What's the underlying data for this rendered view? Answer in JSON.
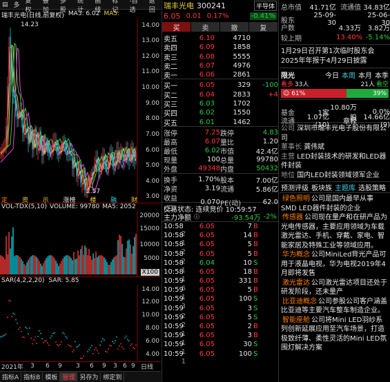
{
  "toolbar": {
    "items": [
      "多",
      "复权",
      "叠加",
      "多股",
      "统计",
      "画线",
      "标记",
      "-自选",
      "返回"
    ]
  },
  "kline": {
    "title": "瑞丰光电(日线,前复权)",
    "ma3_label": "MA3: 6.02",
    "ma5_label": "MA5:",
    "high_label": "14.23",
    "low_label": "2.57",
    "yticks": [
      "14.00",
      "13.00",
      "12.00",
      "11.00",
      "10.00",
      "9.00",
      "8.00",
      "7.00",
      "6.00",
      "5.00",
      "4.00",
      "3.00"
    ],
    "markers": [
      "定",
      "资",
      "示",
      "涨榜",
      "楼",
      "融",
      "财"
    ]
  },
  "volume": {
    "title": "VOL-TDX(5,10)",
    "volume_label": "VOLUME: 99780",
    "ma5_label": "MA5: 2052",
    "yticks": [
      "20000",
      "15000",
      "10000",
      "5000",
      "X100"
    ]
  },
  "sar": {
    "title": "SAR(4,2,2,20)",
    "sar_label": "SAR: 5.85",
    "yticks": [
      "14.00",
      "12.00",
      "10.00",
      "8.00",
      "6.00",
      "4.00"
    ]
  },
  "xaxis": {
    "labels": [
      "2021年",
      "3",
      "6",
      "9",
      "3",
      "6",
      "9",
      "3",
      "6",
      "9"
    ],
    "suffix": "日线"
  },
  "bottom_tabs": [
    "指标A",
    "指标B",
    "模板",
    "管理",
    "另存为",
    "绑定到"
  ],
  "stock": {
    "name": "瑞丰光电",
    "code": "300241",
    "sector": "半导体",
    "sector_change": "-0.41%",
    "price": "6.05",
    "change": "0.01",
    "change_pct": "0.17%"
  },
  "actions": [
    "买",
    "卖",
    "撤",
    "复"
  ],
  "asks": [
    {
      "label": "卖五",
      "price": "6.10",
      "vol": "4710"
    },
    {
      "label": "卖四",
      "price": "6.09",
      "vol": "1858"
    },
    {
      "label": "卖三",
      "price": "6.08",
      "vol": "5555"
    },
    {
      "label": "卖二",
      "price": "6.07",
      "vol": "4976"
    },
    {
      "label": "卖一",
      "price": "6.06",
      "vol": "2861"
    }
  ],
  "bids": [
    {
      "label": "买一",
      "price": "6.05",
      "vol": "329",
      "chg": "-100"
    },
    {
      "label": "买二",
      "price": "6.04",
      "vol": "2833",
      "chg": "+4"
    },
    {
      "label": "买三",
      "price": "6.03",
      "vol": "1702",
      "chg": ""
    },
    {
      "label": "买四",
      "price": "6.02",
      "vol": "1550",
      "chg": ""
    },
    {
      "label": "买五",
      "price": "6.01",
      "vol": "1462",
      "chg": ""
    }
  ],
  "stats": [
    [
      "涨停",
      "7.25",
      "跌停",
      "4.83"
    ],
    [
      "最高",
      "6.07",
      "量比",
      "1.20"
    ],
    [
      "最低",
      "6.02",
      "市值",
      "42.4亿"
    ],
    [
      "现量",
      "100",
      "总量",
      "99780"
    ],
    [
      "外盘",
      "49348",
      "内盘",
      "50432"
    ]
  ],
  "stats2": [
    [
      "换手",
      "1.70%",
      "股本",
      "7.00亿"
    ],
    [
      "净资",
      "3.19",
      "流通",
      "5.86亿"
    ],
    [
      "收益(三)",
      "0.070",
      "PE(动)",
      "62.0"
    ]
  ],
  "trade_status": "交易状态: 连续竞价 10:59:57",
  "net_flow": {
    "label": "主力净额",
    "value": "-93.54万",
    "pct": "-2%"
  },
  "ticks": [
    [
      "10:58",
      "6.05",
      "7",
      "B",
      "2"
    ],
    [
      "10:58",
      "6.05",
      "14",
      "B",
      "1"
    ],
    [
      "10:58",
      "6.05",
      "5",
      "B",
      "2"
    ],
    [
      "10:58",
      "6.05",
      "5",
      "B",
      "2"
    ],
    [
      "10:58",
      "6.04",
      "10",
      "S",
      "1"
    ],
    [
      "10:58",
      "6.05",
      "18",
      "B",
      "1"
    ],
    [
      "10:59",
      "6.05",
      "331",
      "B",
      "6"
    ],
    [
      "10:59",
      "6.05",
      "5",
      "B",
      "1"
    ],
    [
      "10:59",
      "6.05",
      "100",
      "S",
      "3"
    ],
    [
      "10:59",
      "6.05",
      "3",
      "S",
      "2"
    ],
    [
      "10:59",
      "6.05",
      "5",
      "S",
      "2"
    ],
    [
      "10:59",
      "6.05",
      "2",
      "B",
      "1"
    ],
    [
      "10:59",
      "6.05",
      "3",
      "B",
      "1"
    ],
    [
      "10:59",
      "6.05",
      "30",
      "S",
      "1"
    ],
    [
      "10:59",
      "6.05",
      "100",
      "S",
      "1"
    ]
  ],
  "finance": [
    [
      "总市值",
      "41.71亿",
      "流通值",
      "34.83亿"
    ],
    [
      "股东",
      "25-09-30",
      "",
      "25-06-30"
    ],
    [
      "户数",
      "",
      "4.33万",
      "3.82万"
    ],
    [
      "较上期",
      "",
      "13.40%",
      "-5.14%"
    ]
  ],
  "notice": [
    "1月29日召开第1次临时股东会",
    "2025年年报于4月29日披露"
  ],
  "vote": {
    "label": "限光",
    "tabs": [
      "今日",
      "本周",
      "本月",
      "本季"
    ],
    "bull_label": "看多",
    "bull_count": "33人",
    "bear_label": "看空",
    "bear_count": "21人",
    "bull_pct": "61%",
    "bear_pct": "39%"
  },
  "fund": [
    [
      "基金",
      "1家",
      "10.80万股",
      "0.0%"
    ],
    [
      "流通",
      "1.07亿(10)",
      "章程",
      "14.66亿(9)"
    ]
  ],
  "profile": {
    "company_label": "公司",
    "company": "深圳市瑞丰光电子股份有限公司",
    "chair_label": "董事长",
    "chair": "龚伟斌",
    "main_label": "主营",
    "main": "LED封装技术的研发和LED器件封装",
    "pos_label": "地位",
    "pos": "国内LED封装领域领军企业"
  },
  "links": [
    "预测评级",
    "板块族",
    "主题库",
    "选股策略"
  ],
  "themes": [
    {
      "tag": "绿色照明",
      "text": "公司是国内最早从事SMD LED器件封装的企业"
    },
    {
      "tag": "传感器",
      "text": "公司现在量产和在研产品为光电传感器，主要应用领域为车载激光雷达、手机、穿戴、家电、智能家居及特殊工业等领域应用。"
    },
    {
      "tag": "华为概念",
      "text": "公司MiniLed背光产品可用于液晶电视，华为电视2019年4月即将发售"
    },
    {
      "tag": "激光雷达",
      "text": "公司激光雷达项目还处于研发阶段，还未量产"
    },
    {
      "tag": "比亚迪概念",
      "text": "公司参股公司客户涵盖比亚迪等主要汽车整车制造企业。"
    },
    {
      "tag": "智能座舱",
      "text": "公司将Mini LED羽纱系列创新延展应用至汽车场景，打造极致纤薄、柔性灵活的Mini LED氛围灯解决方案"
    }
  ]
}
